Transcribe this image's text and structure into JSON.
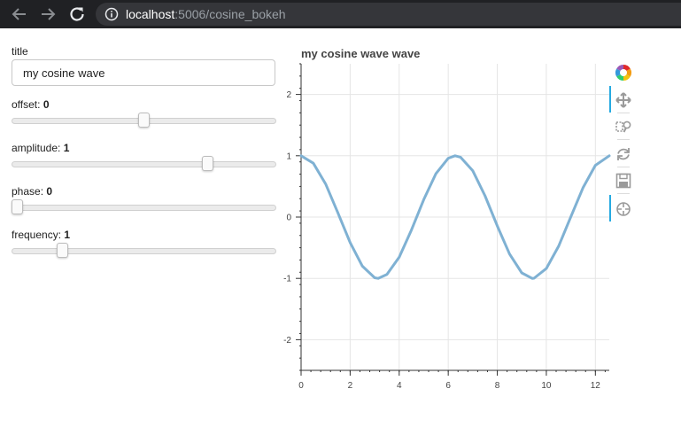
{
  "browser": {
    "url_host": "localhost",
    "url_rest": ":5006/cosine_bokeh",
    "icons": [
      "back-arrow-icon",
      "forward-arrow-icon",
      "reload-icon",
      "info-icon"
    ]
  },
  "widgets": {
    "title": {
      "label": "title",
      "value": "my cosine wave"
    },
    "sliders": [
      {
        "label": "offset: ",
        "value": "0",
        "min": -5,
        "max": 5,
        "current": 0
      },
      {
        "label": "amplitude: ",
        "value": "1",
        "min": -5,
        "max": 3,
        "current": 1
      },
      {
        "label": "phase: ",
        "value": "0",
        "min": 0,
        "max": 6.28,
        "current": 0
      },
      {
        "label": "frequency: ",
        "value": "1",
        "min": 0.1,
        "max": 5.1,
        "current": 1
      }
    ]
  },
  "plot": {
    "title": "my cosine wave wave",
    "line_color": "#7fb1d3",
    "toolbar": [
      "bokeh-logo-icon",
      "pan-icon",
      "box-zoom-icon",
      "reset-icon",
      "save-icon",
      "hover-icon"
    ]
  },
  "chart_data": {
    "type": "line",
    "title": "my cosine wave wave",
    "xlabel": "",
    "ylabel": "",
    "xlim": [
      0,
      12.566
    ],
    "ylim": [
      -2.5,
      2.5
    ],
    "xticks": [
      0,
      2,
      4,
      6,
      8,
      10,
      12
    ],
    "yticks": [
      -2,
      -1,
      0,
      1,
      2
    ],
    "grid": true,
    "series": [
      {
        "x": [
          0,
          0.5,
          1.0,
          1.5,
          2.0,
          2.5,
          3.0,
          3.14,
          3.5,
          4.0,
          4.5,
          5.0,
          5.5,
          6.0,
          6.28,
          6.5,
          7.0,
          7.5,
          8.0,
          8.5,
          9.0,
          9.42,
          9.5,
          10.0,
          10.5,
          11.0,
          11.5,
          12.0,
          12.566
        ],
        "y": [
          1.0,
          0.878,
          0.54,
          0.071,
          -0.416,
          -0.801,
          -0.99,
          -1.0,
          -0.936,
          -0.654,
          -0.211,
          0.284,
          0.709,
          0.96,
          1.0,
          0.977,
          0.754,
          0.347,
          -0.146,
          -0.602,
          -0.911,
          -1.0,
          -0.997,
          -0.839,
          -0.476,
          0.004,
          0.483,
          0.844,
          1.0
        ]
      }
    ]
  }
}
